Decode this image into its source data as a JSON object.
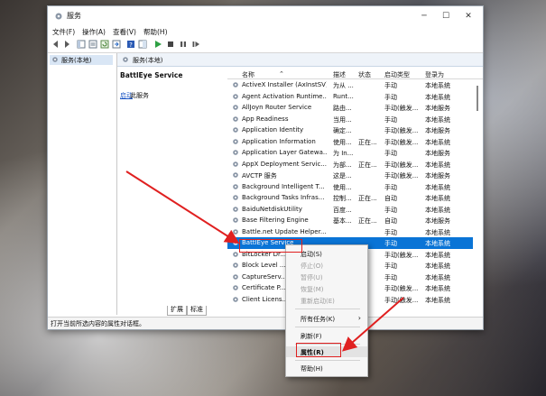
{
  "window": {
    "title": "服务"
  },
  "menu": [
    "文件(F)",
    "操作(A)",
    "查看(V)",
    "帮助(H)"
  ],
  "tree": {
    "root_label": "服务(本地)"
  },
  "content_header": "服务(本地)",
  "detail": {
    "service_name": "BattlEye Service",
    "start_link": "启动",
    "start_rest": "此服务"
  },
  "columns": [
    "名称",
    "描述",
    "状态",
    "启动类型",
    "登录为"
  ],
  "services": [
    [
      "ActiveX Installer (AxInstSV)",
      "为从 ...",
      "",
      "手动",
      "本地系统"
    ],
    [
      "Agent Activation Runtime...",
      "Runt...",
      "",
      "手动",
      "本地系统"
    ],
    [
      "AllJoyn Router Service",
      "路由...",
      "",
      "手动(触发...",
      "本地服务"
    ],
    [
      "App Readiness",
      "当用...",
      "",
      "手动",
      "本地系统"
    ],
    [
      "Application Identity",
      "确定...",
      "",
      "手动(触发...",
      "本地服务"
    ],
    [
      "Application Information",
      "使用...",
      "正在...",
      "手动(触发...",
      "本地系统"
    ],
    [
      "Application Layer Gatewa...",
      "为 In...",
      "",
      "手动",
      "本地服务"
    ],
    [
      "AppX Deployment Servic...",
      "为部...",
      "正在...",
      "手动(触发...",
      "本地系统"
    ],
    [
      "AVCTP 服务",
      "这是...",
      "",
      "手动(触发...",
      "本地服务"
    ],
    [
      "Background Intelligent T...",
      "使用...",
      "",
      "手动",
      "本地系统"
    ],
    [
      "Background Tasks Infras...",
      "控制...",
      "正在...",
      "自动",
      "本地系统"
    ],
    [
      "BaiduNetdiskUtility",
      "百度...",
      "",
      "手动",
      "本地系统"
    ],
    [
      "Base Filtering Engine",
      "基本...",
      "正在...",
      "自动",
      "本地服务"
    ],
    [
      "Battle.net Update Helper...",
      "",
      "",
      "手动",
      "本地系统"
    ],
    [
      "BattlEye Service",
      "",
      "",
      "手动",
      "本地系统"
    ],
    [
      "BitLocker Dr...",
      "",
      "",
      "手动(触发...",
      "本地系统"
    ],
    [
      "Block Level ...",
      "",
      "",
      "手动",
      "本地系统"
    ],
    [
      "CaptureServ...",
      "",
      "",
      "手动",
      "本地系统"
    ],
    [
      "Certificate P...",
      "",
      "",
      "手动(触发...",
      "本地系统"
    ],
    [
      "Client Licens...",
      "",
      "",
      "手动(触发...",
      "本地系统"
    ]
  ],
  "tabs": [
    "扩展",
    "标准"
  ],
  "status": "打开当前所选内容的属性对话框。",
  "context_menu": {
    "start": "启动(S)",
    "stop": "停止(O)",
    "pause": "暂停(U)",
    "resume": "恢复(M)",
    "restart": "重新启动(E)",
    "all_tasks": "所有任务(K)",
    "refresh": "刷新(F)",
    "properties": "属性(R)",
    "help": "帮助(H)"
  },
  "colors": {
    "selection": "#0a74d6",
    "annotation": "#e02020",
    "link": "#1a55c4"
  }
}
